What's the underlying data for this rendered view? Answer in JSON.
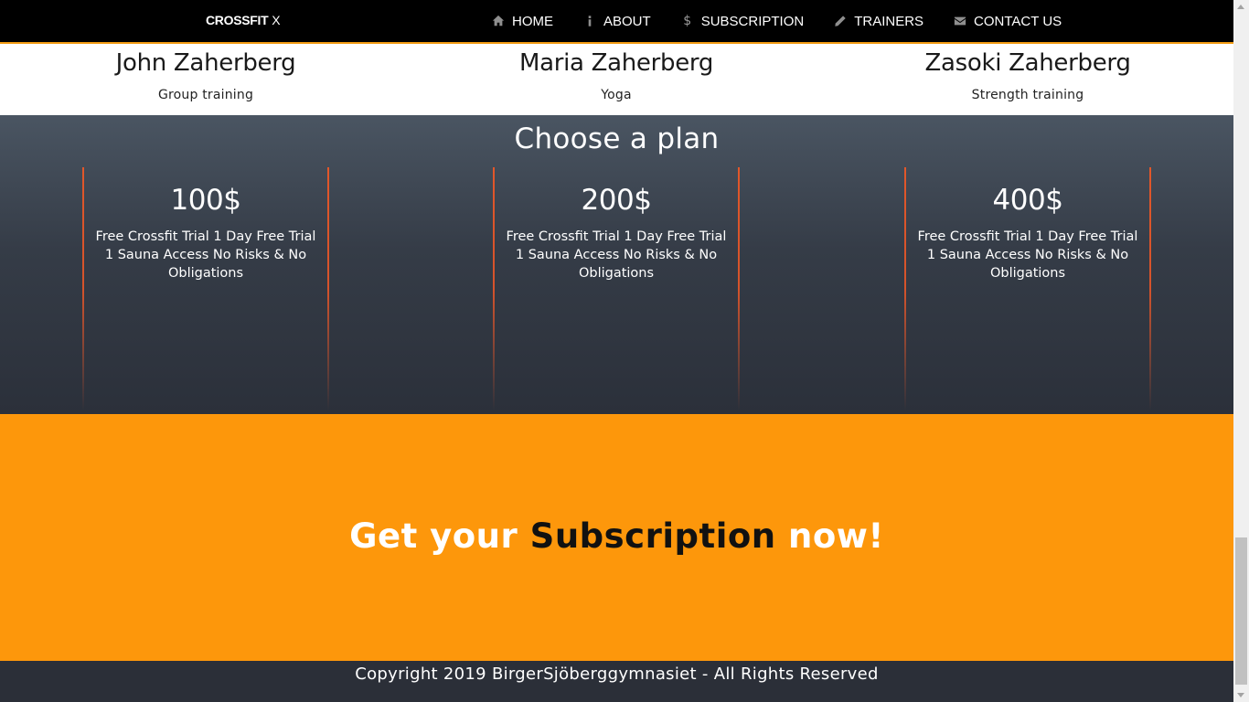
{
  "nav": {
    "brand_bold": "CROSSFIT",
    "brand_light": "X",
    "items": [
      {
        "label": "HOME",
        "icon": "home-icon"
      },
      {
        "label": "ABOUT",
        "icon": "info-icon"
      },
      {
        "label": "SUBSCRIPTION",
        "icon": "dollar-icon"
      },
      {
        "label": "TRAINERS",
        "icon": "pencil-icon"
      },
      {
        "label": "CONTACT US",
        "icon": "envelope-icon"
      }
    ]
  },
  "trainers": [
    {
      "name": "John Zaherberg",
      "role": "Group training"
    },
    {
      "name": "Maria Zaherberg",
      "role": "Yoga"
    },
    {
      "name": "Zasoki Zaherberg",
      "role": "Strength training"
    }
  ],
  "plans": {
    "title": "Choose a plan",
    "items": [
      {
        "price": "100$",
        "desc": "Free Crossfit Trial 1 Day Free Trial 1 Sauna Access No Risks & No Obligations"
      },
      {
        "price": "200$",
        "desc": "Free Crossfit Trial 1 Day Free Trial 1 Sauna Access No Risks & No Obligations"
      },
      {
        "price": "400$",
        "desc": "Free Crossfit Trial 1 Day Free Trial 1 Sauna Access No Risks & No Obligations"
      }
    ]
  },
  "cta": {
    "part1": "Get your",
    "part2": "Subscription",
    "part3": "now!"
  },
  "footer": {
    "copyright": "Copyright 2019 BirgerSjöberggymnasiet - All Rights Reserved"
  },
  "colors": {
    "navbar_bg": "#000000",
    "accent_orange": "#fd970b",
    "plan_border": "#e2572a",
    "footer_bg": "#2b2f38"
  }
}
